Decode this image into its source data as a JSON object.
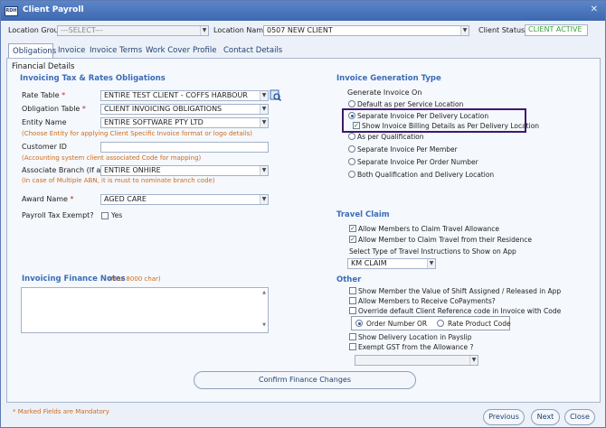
{
  "title": "Client Payroll",
  "logo_text": "RDH",
  "header": {
    "group_label": "Location Group",
    "group_value": "---SELECT---",
    "name_label": "Location Name",
    "name_value": "0507 NEW CLIENT",
    "status_label": "Client Status",
    "status_value": "CLIENT ACTIVE"
  },
  "tabs": [
    "Obligations",
    "Invoice",
    "Invoice Terms",
    "Work Cover",
    "Profile",
    "Contact Details"
  ],
  "panel_title": "Financial Details",
  "left": {
    "section": "Invoicing Tax & Rates Obligations",
    "rate_label": "Rate Table",
    "rate_value": "ENTIRE TEST CLIENT - COFFS HARBOUR",
    "obligation_label": "Obligation Table",
    "obligation_value": "CLIENT INVOICING OBLIGATIONS",
    "entity_label": "Entity Name",
    "entity_value": "ENTIRE SOFTWARE PTY LTD",
    "entity_note": "(Choose Entity for applying Client Specific Invoice format or logo details)",
    "customer_label": "Customer ID",
    "customer_value": "",
    "customer_note": "(Accounting system client associated Code for mapping)",
    "branch_label": "Associate Branch (If any)",
    "branch_value": "ENTIRE ONHIRE",
    "branch_note": "(In case of Multiple ABN, it is must to nominate branch code)",
    "award_label": "Award Name",
    "award_value": "AGED CARE",
    "payroll_label": "Payroll Tax Exempt?",
    "payroll_yes": "Yes",
    "notes_label": "Invoicing Finance Notes",
    "notes_max": "(Max 8000 char)",
    "star": "*"
  },
  "right": {
    "section": "Invoice Generation Type",
    "gen_label": "Generate Invoice On",
    "options": [
      "Default as per Service Location",
      "Separate Invoice Per Delivery Location",
      "Show Invoice Billing Details as Per Delivery Location",
      "As per Qualification",
      "Separate Invoice Per Member",
      "Separate Invoice Per Order Number",
      "Both Qualification and Delivery Location"
    ],
    "travel_section": "Travel Claim",
    "travel_opts": [
      "Allow Members to Claim Travel Allowance",
      "Allow Member to Claim Travel from their Residence"
    ],
    "travel_type_label": "Select Type of Travel Instructions to Show on App",
    "travel_type_value": "KM CLAIM",
    "other_section": "Other",
    "other_opts": [
      "Show Member the Value of Shift Assigned / Released in App",
      "Allow Members to Receive CoPayments?",
      "Override default Client Reference code in Invoice with Code"
    ],
    "order_number": "Order Number",
    "or_text": "OR",
    "rate_product_code": "Rate Product Code",
    "other_opts2": [
      "Show Delivery Location in Payslip",
      "Exempt GST from the Allowance ?"
    ]
  },
  "confirm_button": "Confirm Finance Changes",
  "mandatory_note": "* Marked Fields are Mandatory",
  "nav": {
    "previous": "Previous",
    "next": "Next",
    "close": "Close"
  },
  "colors": {
    "accent": "#3b6cb7",
    "note": "#d06a1a",
    "highlight": "#3f1a6b",
    "status": "#3e9e3e"
  }
}
